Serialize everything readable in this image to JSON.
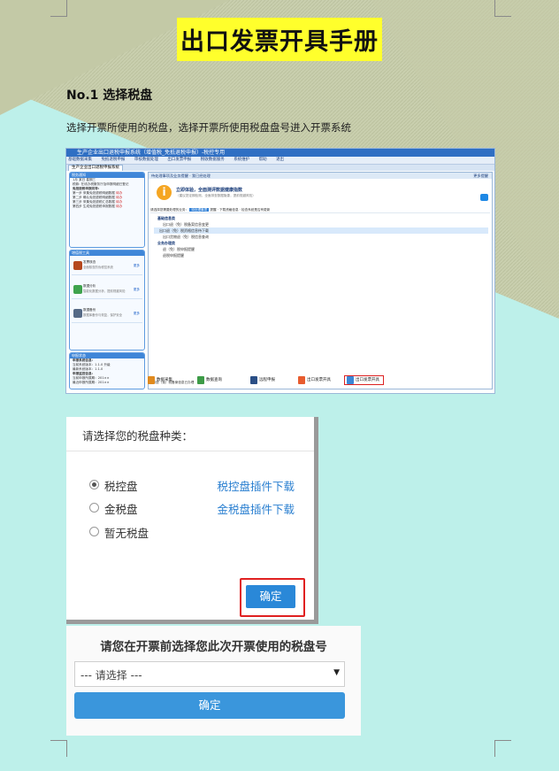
{
  "document": {
    "title": "出口发票开具手册",
    "section_heading": "No.1 选择税盘",
    "section_text": "选择开票所使用的税盘，选择开票所使用税盘盘号进入开票系统"
  },
  "screenshot1": {
    "window_title": "生产企业出口退税申报系统（增值税_免抵退税申报）-税控专用",
    "menu": [
      "基础数据采集",
      "免抵退税申报",
      "审核数据处理",
      "出口发票申报",
      "税收数据服务",
      "系统维护",
      "帮助",
      "退出"
    ],
    "tab": "生产企业出口退税申报系统",
    "left_panel": {
      "header": "税务通知",
      "date_line": "1月 某日 星期三",
      "notice_line": "税款: 在线办税服务厅及申报明细已登记",
      "steps_heading": "免抵退税申报向导:",
      "steps": [
        {
          "text": "第一步 采集免抵退税明细数据",
          "flag": "待办"
        },
        {
          "text": "第二步 确认免抵退税明细数据",
          "flag": "待办"
        },
        {
          "text": "第三步 采集免抵退税汇总数据",
          "flag": "待办"
        },
        {
          "text": "第四步 生成免抵退税申报数据",
          "flag": "待办"
        }
      ]
    },
    "quick_panel": {
      "header": "增值税工具",
      "items": [
        {
          "title": "发票核查",
          "desc": "全面核查防伪税控系统",
          "link": "更多"
        },
        {
          "title": "数据分析",
          "desc": "智能化数据分析，提前规避风险",
          "link": "更多"
        },
        {
          "title": "数据备份",
          "desc": "数据库备份与恢复，保护安全",
          "link": "更多"
        }
      ]
    },
    "status_panel": {
      "header": "申报状态",
      "lines": [
        "申报系统信息:",
        "当前系统版本：1.1.0 升级",
        "最新系统版本：1.1.0",
        "申报监控信息:",
        "当前申报所属期：201××",
        "最近申报所属期：201××"
      ]
    },
    "main": {
      "header": "待处理事项及业务提醒 · 我已经处理",
      "more": "更多提醒",
      "info_title": "立即体验，全面测评数据健康指数",
      "info_sub": "（建议您定期检测，全面排查数据隐患，提前规避风险）",
      "filter_label": "请选择您需要处理的业务：",
      "filter_active": "待处理事项",
      "filter_rest": "提醒 · 下载资格信息 · 检查系统是否有更新",
      "tree": [
        {
          "text": "基础信息类",
          "style": "bold"
        },
        {
          "text": "出口退（免）税备案信息变更",
          "style": "indent"
        },
        {
          "text": "出口退（免）税资格信息待下载",
          "style": "selected"
        },
        {
          "text": "出口货物退（免）税信息查询",
          "style": "indent"
        },
        {
          "text": "业务办理类",
          "style": "bold"
        },
        {
          "text": "退（免）税申报提醒",
          "style": "indent"
        },
        {
          "text": "退税申报提醒",
          "style": "indent"
        }
      ],
      "footer_line": "出口退（免）税备案信息已办理"
    },
    "bottom_buttons": [
      "数据采集",
      "数据查询",
      "远程申报",
      "出口发票开具",
      "出口发票开具"
    ]
  },
  "dialog1": {
    "title": "请选择您的税盘种类：",
    "options": [
      {
        "label": "税控盘",
        "link": "税控盘插件下载",
        "checked": true
      },
      {
        "label": "金税盘",
        "link": "金税盘插件下载",
        "checked": false
      },
      {
        "label": "暂无税盘",
        "link": "",
        "checked": false
      }
    ],
    "ok": "确定"
  },
  "dialog2": {
    "title": "请您在开票前选择您此次开票使用的税盘号",
    "select_value": "--- 请选择 ---",
    "ok": "确定"
  }
}
